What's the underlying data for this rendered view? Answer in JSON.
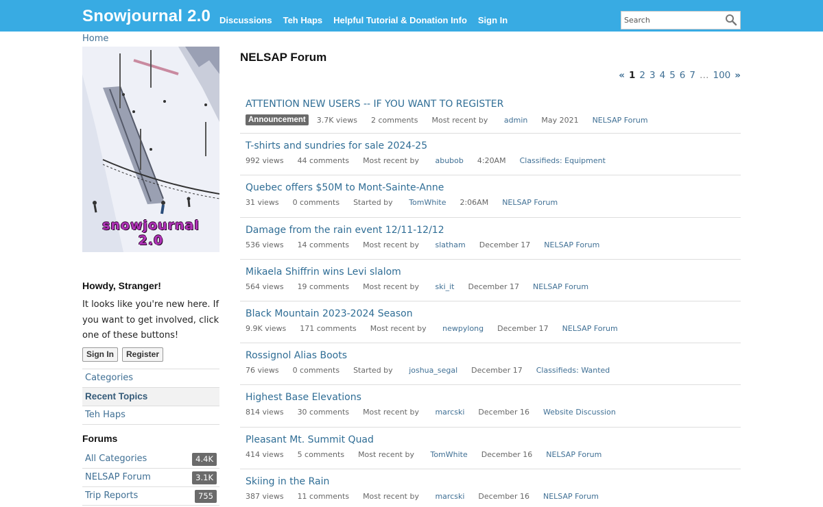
{
  "header": {
    "brand": "Snowjournal 2.0",
    "nav": [
      "Discussions",
      "Teh Haps",
      "Helpful Tutorial & Donation Info",
      "Sign In"
    ],
    "search_placeholder": "Search"
  },
  "breadcrumb": "Home",
  "logo_text": [
    "snowjournal",
    "2.0"
  ],
  "howdy": {
    "title": "Howdy, Stranger!",
    "text": "It looks like you're new here. If you want to get involved, click one of these buttons!",
    "signin_label": "Sign In",
    "register_label": "Register"
  },
  "sidenav": [
    {
      "label": "Categories",
      "active": false
    },
    {
      "label": "Recent Topics",
      "active": true
    },
    {
      "label": "Teh Haps",
      "active": false
    }
  ],
  "forums": {
    "title": "Forums",
    "items": [
      {
        "label": "All Categories",
        "count": "4.4K"
      },
      {
        "label": "NELSAP Forum",
        "count": "3.1K"
      },
      {
        "label": "Trip Reports",
        "count": "755"
      }
    ]
  },
  "main": {
    "title": "NELSAP Forum",
    "pager": {
      "prev": "«",
      "pages": [
        "1",
        "2",
        "3",
        "4",
        "5",
        "6",
        "7"
      ],
      "ellipsis": "…",
      "last": "100",
      "next": "»",
      "current": "1"
    },
    "topics": [
      {
        "title": "ATTENTION NEW USERS -- IF YOU WANT TO REGISTER",
        "badge": "Announcement",
        "views": "3.7K views",
        "comments": "2 comments",
        "recent_label": "Most recent by",
        "who": "admin",
        "when": "May 2021",
        "category": "NELSAP Forum"
      },
      {
        "title": "T-shirts and sundries for sale 2024-25",
        "badge": "",
        "views": "992 views",
        "comments": "44 comments",
        "recent_label": "Most recent by",
        "who": "abubob",
        "when": "4:20AM",
        "category": "Classifieds: Equipment"
      },
      {
        "title": "Quebec offers $50M to Mont-Sainte-Anne",
        "badge": "",
        "views": "31 views",
        "comments": "0 comments",
        "recent_label": "Started by",
        "who": "TomWhite",
        "when": "2:06AM",
        "category": "NELSAP Forum"
      },
      {
        "title": "Damage from the rain event 12/11-12/12",
        "badge": "",
        "views": "536 views",
        "comments": "14 comments",
        "recent_label": "Most recent by",
        "who": "slatham",
        "when": "December 17",
        "category": "NELSAP Forum"
      },
      {
        "title": "Mikaela Shiffrin wins Levi slalom",
        "badge": "",
        "views": "564 views",
        "comments": "19 comments",
        "recent_label": "Most recent by",
        "who": "ski_it",
        "when": "December 17",
        "category": "NELSAP Forum"
      },
      {
        "title": "Black Mountain 2023-2024 Season",
        "badge": "",
        "views": "9.9K views",
        "comments": "171 comments",
        "recent_label": "Most recent by",
        "who": "newpylong",
        "when": "December 17",
        "category": "NELSAP Forum"
      },
      {
        "title": "Rossignol Alias Boots",
        "badge": "",
        "views": "76 views",
        "comments": "0 comments",
        "recent_label": "Started by",
        "who": "joshua_segal",
        "when": "December 17",
        "category": "Classifieds: Wanted"
      },
      {
        "title": "Highest Base Elevations",
        "badge": "",
        "views": "814 views",
        "comments": "30 comments",
        "recent_label": "Most recent by",
        "who": "marcski",
        "when": "December 16",
        "category": "Website Discussion"
      },
      {
        "title": "Pleasant Mt. Summit Quad",
        "badge": "",
        "views": "414 views",
        "comments": "5 comments",
        "recent_label": "Most recent by",
        "who": "TomWhite",
        "when": "December 16",
        "category": "NELSAP Forum"
      },
      {
        "title": "Skiing in the Rain",
        "badge": "",
        "views": "387 views",
        "comments": "11 comments",
        "recent_label": "Most recent by",
        "who": "marcski",
        "when": "December 16",
        "category": "NELSAP Forum"
      }
    ]
  },
  "colors": {
    "header_bg": "#38abe3",
    "link": "#2f6d95",
    "badge_bg": "#6a6a6a",
    "logo_text": "#b032b8"
  }
}
